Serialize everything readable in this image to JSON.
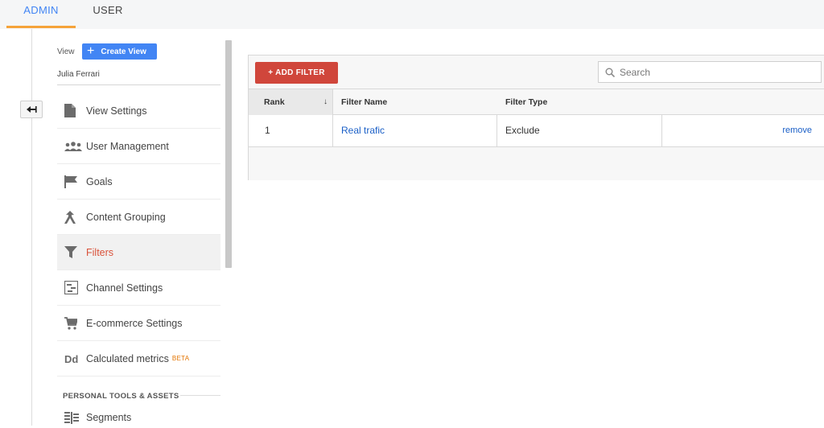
{
  "tabs": {
    "admin": "ADMIN",
    "user": "USER"
  },
  "view": {
    "label": "View",
    "create_button": "Create View",
    "name": "Julia Ferrari"
  },
  "menu": {
    "items": [
      {
        "label": "View Settings",
        "icon": "document-icon"
      },
      {
        "label": "User Management",
        "icon": "users-icon"
      },
      {
        "label": "Goals",
        "icon": "flag-icon"
      },
      {
        "label": "Content Grouping",
        "icon": "content-grouping-icon"
      },
      {
        "label": "Filters",
        "icon": "filter-icon",
        "active": true
      },
      {
        "label": "Channel Settings",
        "icon": "channel-icon"
      },
      {
        "label": "E-commerce Settings",
        "icon": "cart-icon"
      },
      {
        "label": "Calculated metrics",
        "icon": "dd-icon",
        "badge": "BETA"
      }
    ],
    "section_heading": "PERSONAL TOOLS & ASSETS",
    "section_items": [
      {
        "label": "Segments",
        "icon": "segments-icon"
      }
    ]
  },
  "toolbar": {
    "add_filter": "+ ADD FILTER",
    "search_placeholder": "Search"
  },
  "table": {
    "columns": [
      "Rank",
      "Filter Name",
      "Filter Type"
    ],
    "rows": [
      {
        "rank": "1",
        "name": "Real trafic",
        "type": "Exclude",
        "action": "remove"
      }
    ]
  },
  "colors": {
    "accent": "#4285f4",
    "tab_underline": "#f5a33a",
    "add_button": "#d0463b",
    "link": "#1a5fc7",
    "active_menu": "#d9523a"
  }
}
